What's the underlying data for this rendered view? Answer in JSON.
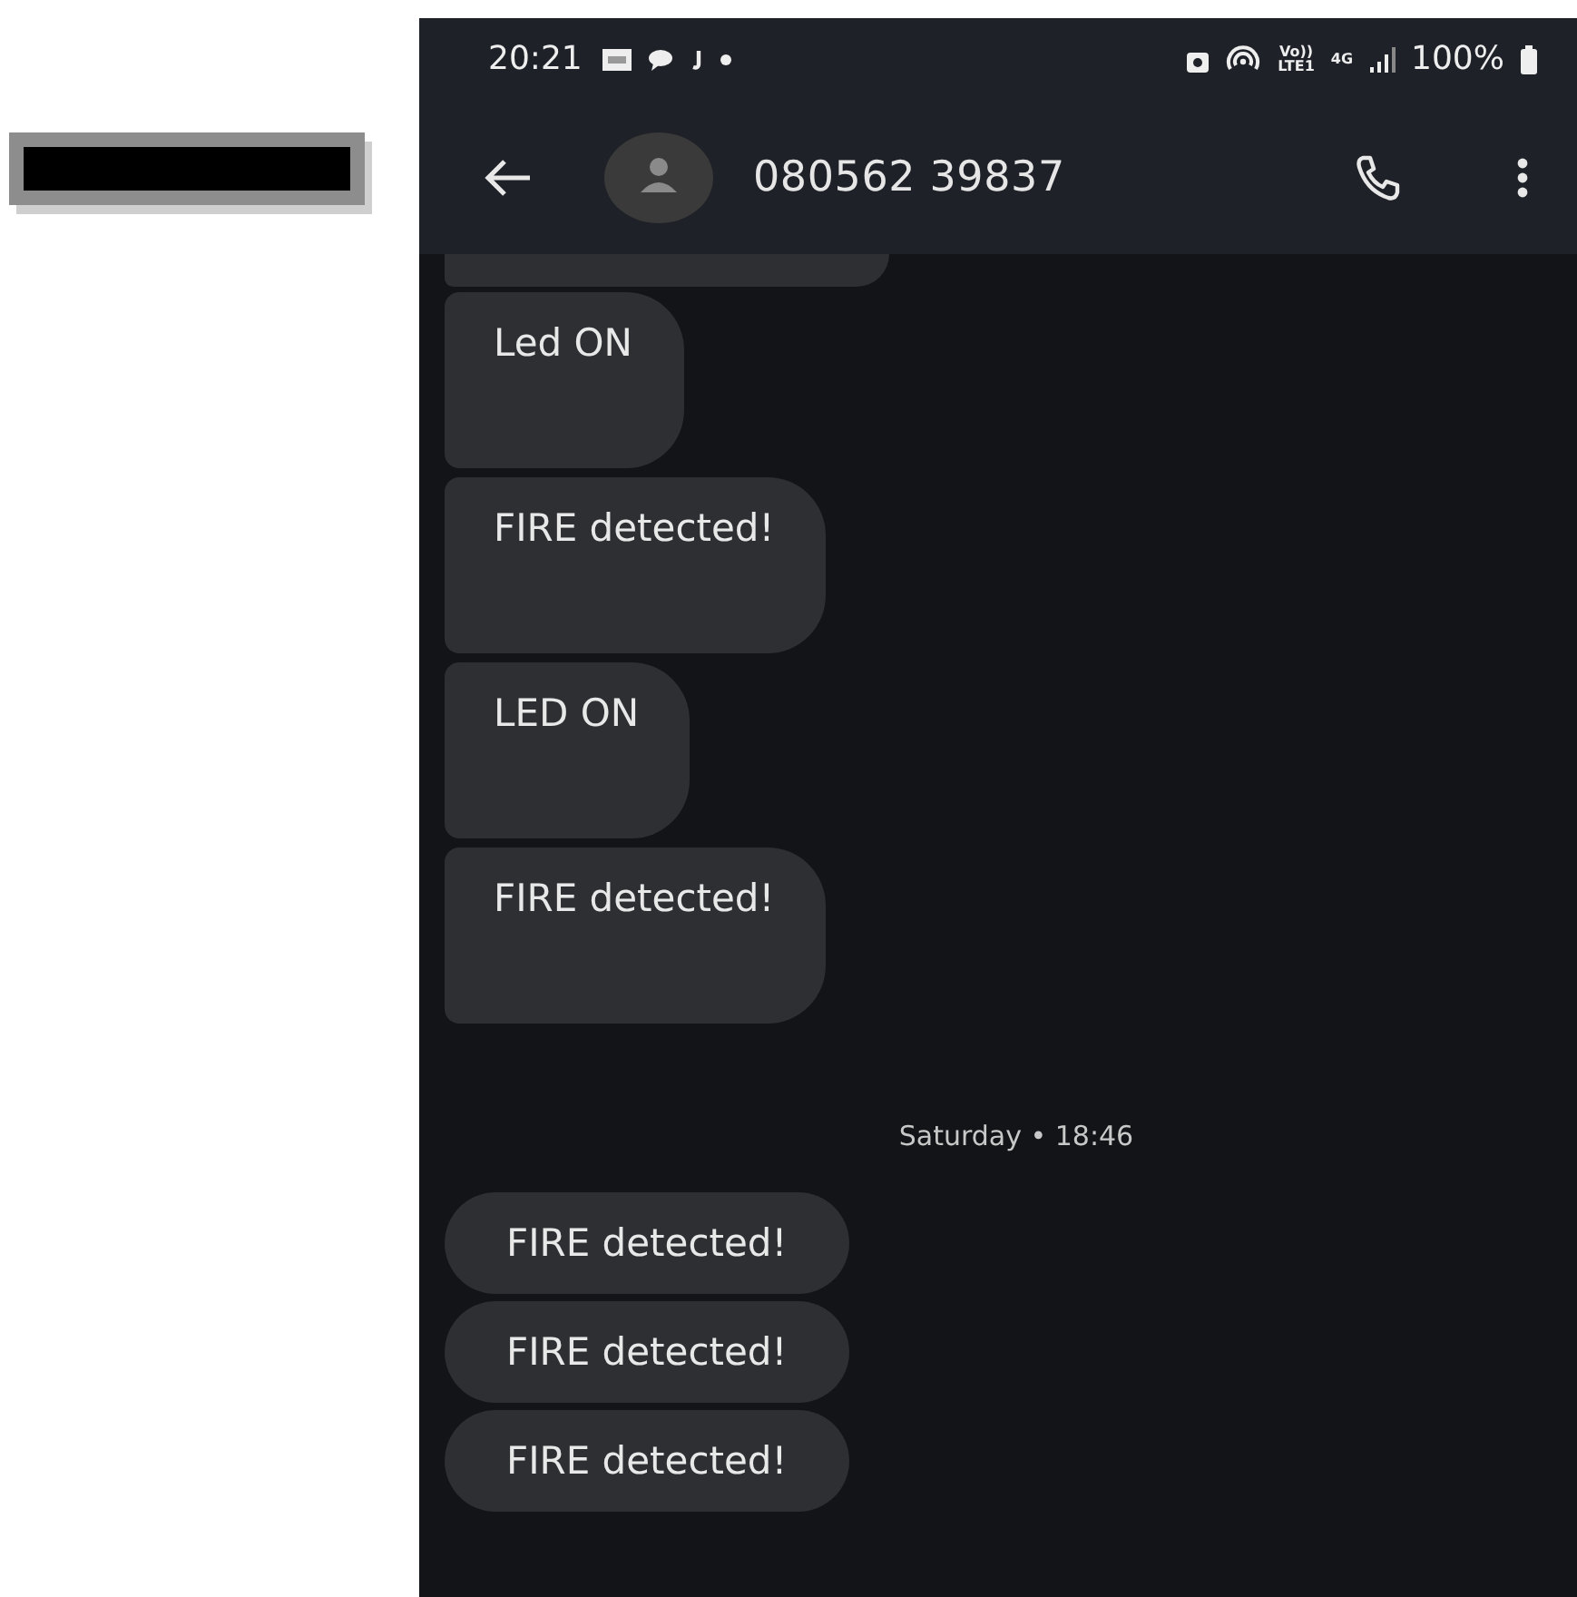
{
  "status_bar": {
    "time": "20:21",
    "volte": [
      "Vo))",
      "LTE1"
    ],
    "network": "4G",
    "battery": "100%"
  },
  "header": {
    "contact": "080562 39837"
  },
  "messages": [
    {
      "kind": "cut"
    },
    {
      "kind": "tall",
      "text": "Led ON"
    },
    {
      "kind": "tall",
      "text": "FIRE detected!"
    },
    {
      "kind": "tall",
      "text": "LED ON"
    },
    {
      "kind": "tall",
      "text": "FIRE detected!"
    },
    {
      "kind": "time",
      "text": "Saturday • 18:46"
    },
    {
      "kind": "compact",
      "text": "FIRE detected!"
    },
    {
      "kind": "compact",
      "text": "FIRE detected!"
    },
    {
      "kind": "compact",
      "text": "FIRE detected!"
    }
  ]
}
